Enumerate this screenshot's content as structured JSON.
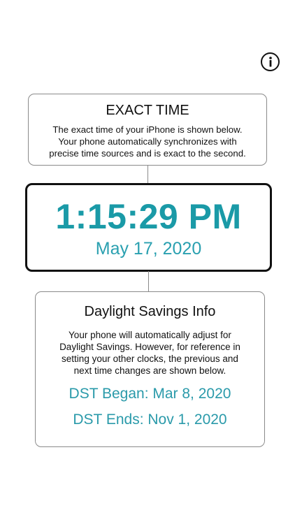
{
  "header": {
    "info_icon": "info-circle-icon"
  },
  "exact_time": {
    "title": "EXACT TIME",
    "description": "The exact time of your iPhone is shown below.\nYour phone automatically synchronizes with\nprecise time sources and is exact to the second."
  },
  "clock": {
    "time": "1:15:29 PM",
    "date": "May 17, 2020",
    "accent_color": "#1a9aa7"
  },
  "dst": {
    "title": "Daylight Savings Info",
    "description": "Your phone will automatically adjust for\nDaylight Savings.  However, for reference in\nsetting your other clocks, the previous and\nnext time changes are shown below.",
    "began": "DST Began: Mar 8, 2020",
    "ends": "DST Ends: Nov 1, 2020"
  }
}
